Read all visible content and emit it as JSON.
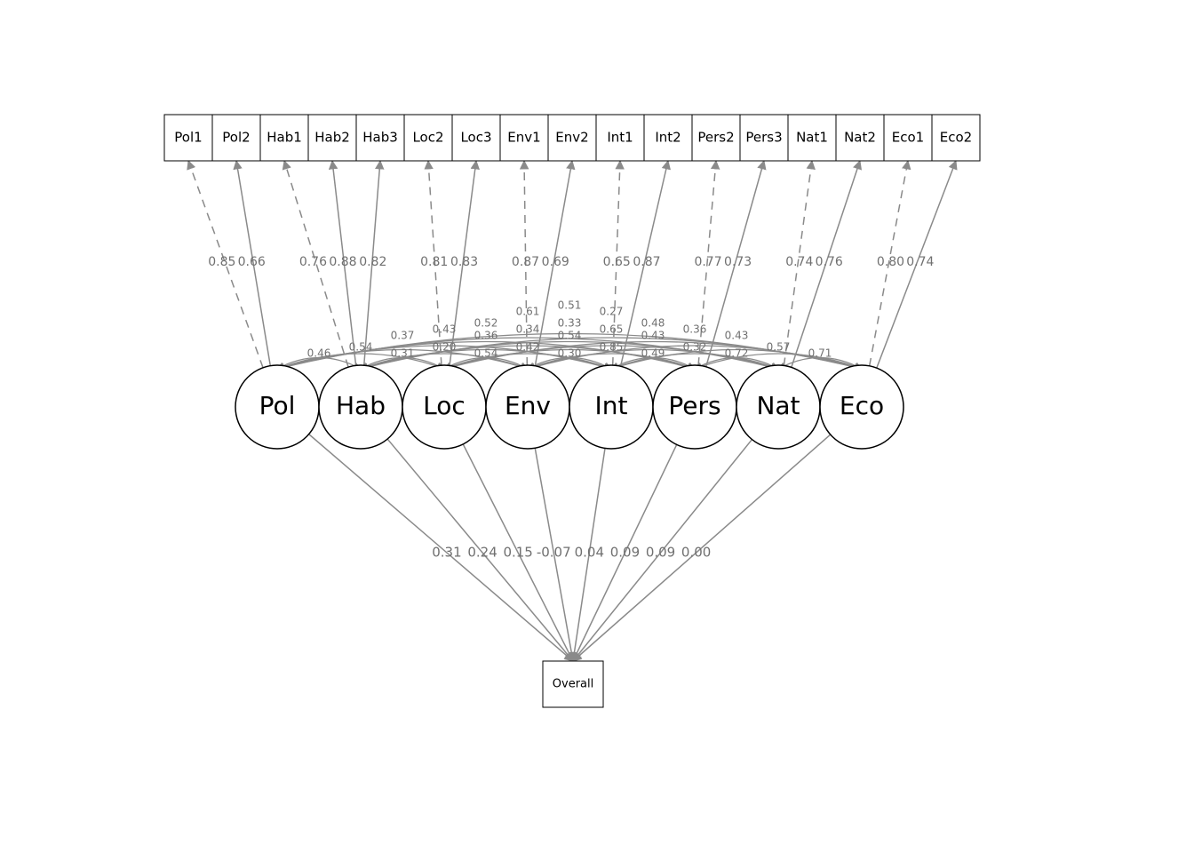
{
  "indicators": [
    {
      "id": "Pol1",
      "label": "Pol1",
      "latent": "Pol",
      "dashed": true,
      "load": "0.85"
    },
    {
      "id": "Pol2",
      "label": "Pol2",
      "latent": "Pol",
      "dashed": false,
      "load": "0.66"
    },
    {
      "id": "Hab1",
      "label": "Hab1",
      "latent": "Hab",
      "dashed": true,
      "load": "0.76"
    },
    {
      "id": "Hab2",
      "label": "Hab2",
      "latent": "Hab",
      "dashed": false,
      "load": "0.88"
    },
    {
      "id": "Hab3",
      "label": "Hab3",
      "latent": "Hab",
      "dashed": false,
      "load": "0.82"
    },
    {
      "id": "Loc2",
      "label": "Loc2",
      "latent": "Loc",
      "dashed": true,
      "load": "0.81"
    },
    {
      "id": "Loc3",
      "label": "Loc3",
      "latent": "Loc",
      "dashed": false,
      "load": "0.83"
    },
    {
      "id": "Env1",
      "label": "Env1",
      "latent": "Env",
      "dashed": true,
      "load": "0.87"
    },
    {
      "id": "Env2",
      "label": "Env2",
      "latent": "Env",
      "dashed": false,
      "load": "0.69"
    },
    {
      "id": "Int1",
      "label": "Int1",
      "latent": "Int",
      "dashed": true,
      "load": "0.65"
    },
    {
      "id": "Int2",
      "label": "Int2",
      "latent": "Int",
      "dashed": false,
      "load": "0.87"
    },
    {
      "id": "Pers2",
      "label": "Pers2",
      "latent": "Pers",
      "dashed": true,
      "load": "0.77"
    },
    {
      "id": "Pers3",
      "label": "Pers3",
      "latent": "Pers",
      "dashed": false,
      "load": "0.73"
    },
    {
      "id": "Nat1",
      "label": "Nat1",
      "latent": "Nat",
      "dashed": true,
      "load": "0.74"
    },
    {
      "id": "Nat2",
      "label": "Nat2",
      "latent": "Nat",
      "dashed": false,
      "load": "0.76"
    },
    {
      "id": "Eco1",
      "label": "Eco1",
      "latent": "Eco",
      "dashed": true,
      "load": "0.80"
    },
    {
      "id": "Eco2",
      "label": "Eco2",
      "latent": "Eco",
      "dashed": false,
      "load": "0.74"
    }
  ],
  "latents": [
    {
      "id": "Pol",
      "label": "Pol",
      "reg": "0.31"
    },
    {
      "id": "Hab",
      "label": "Hab",
      "reg": "0.24"
    },
    {
      "id": "Loc",
      "label": "Loc",
      "reg": "0.15"
    },
    {
      "id": "Env",
      "label": "Env",
      "reg": "-0.07"
    },
    {
      "id": "Int",
      "label": "Int",
      "reg": "0.04"
    },
    {
      "id": "Pers",
      "label": "Pers",
      "reg": "0.09"
    },
    {
      "id": "Nat",
      "label": "Nat",
      "reg": "0.09"
    },
    {
      "id": "Eco",
      "label": "Eco",
      "reg": "0.00"
    }
  ],
  "overall": {
    "label": "Overall"
  },
  "correlations": [
    {
      "a": "Pol",
      "b": "Hab",
      "v": "0.46"
    },
    {
      "a": "Pol",
      "b": "Loc",
      "v": "0.54"
    },
    {
      "a": "Pol",
      "b": "Env",
      "v": "0.37"
    },
    {
      "a": "Pol",
      "b": "Int",
      "v": "0.43"
    },
    {
      "a": "Pol",
      "b": "Pers",
      "v": "0.52"
    },
    {
      "a": "Pol",
      "b": "Nat",
      "v": "0.61"
    },
    {
      "a": "Pol",
      "b": "Eco",
      "v": "0.51"
    },
    {
      "a": "Hab",
      "b": "Loc",
      "v": "0.31"
    },
    {
      "a": "Hab",
      "b": "Env",
      "v": "0.20"
    },
    {
      "a": "Hab",
      "b": "Int",
      "v": "0.36"
    },
    {
      "a": "Hab",
      "b": "Pers",
      "v": "0.34"
    },
    {
      "a": "Hab",
      "b": "Nat",
      "v": "0.33"
    },
    {
      "a": "Hab",
      "b": "Eco",
      "v": "0.27"
    },
    {
      "a": "Loc",
      "b": "Env",
      "v": "0.54"
    },
    {
      "a": "Loc",
      "b": "Int",
      "v": "0.42"
    },
    {
      "a": "Loc",
      "b": "Pers",
      "v": "0.54"
    },
    {
      "a": "Loc",
      "b": "Nat",
      "v": "0.65"
    },
    {
      "a": "Loc",
      "b": "Eco",
      "v": "0.48"
    },
    {
      "a": "Env",
      "b": "Int",
      "v": "0.30"
    },
    {
      "a": "Env",
      "b": "Pers",
      "v": "0.85"
    },
    {
      "a": "Env",
      "b": "Nat",
      "v": "0.43"
    },
    {
      "a": "Env",
      "b": "Eco",
      "v": "0.36"
    },
    {
      "a": "Int",
      "b": "Pers",
      "v": "0.49"
    },
    {
      "a": "Int",
      "b": "Nat",
      "v": "0.32"
    },
    {
      "a": "Int",
      "b": "Eco",
      "v": "0.43"
    },
    {
      "a": "Pers",
      "b": "Nat",
      "v": "0.72"
    },
    {
      "a": "Pers",
      "b": "Eco",
      "v": "0.57"
    },
    {
      "a": "Nat",
      "b": "Eco",
      "v": "0.71"
    }
  ]
}
